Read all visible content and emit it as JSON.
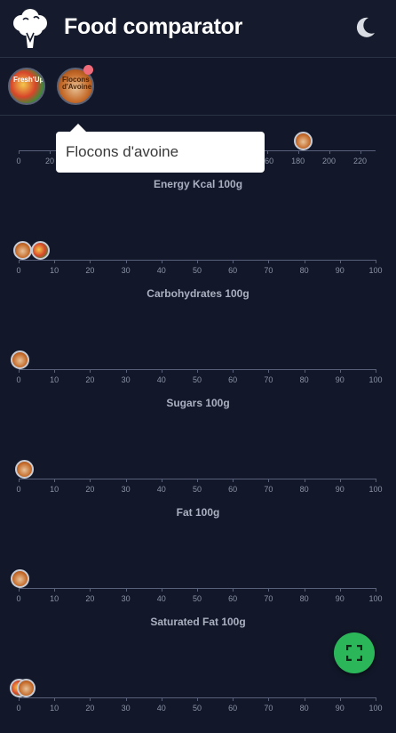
{
  "header": {
    "title": "Food comparator",
    "logo_icon": "broccoli-icon",
    "theme_toggle_icon": "moon-icon"
  },
  "selected_products": [
    {
      "name": "pizza",
      "label": "Fresh'Up"
    },
    {
      "name": "oat-flakes",
      "label": "Flocons d'Avoine"
    }
  ],
  "tooltip": {
    "text": "Flocons d'avoine"
  },
  "colors": {
    "background": "#121829",
    "fab": "#2bb65a",
    "badge": "#f06b7a"
  },
  "fab": {
    "icon": "fullscreen-icon"
  },
  "chart_data": [
    {
      "type": "scatter",
      "title": "Energy Kcal 100g",
      "ticks": [
        "0",
        "20",
        "40",
        "60",
        "80",
        "100",
        "120",
        "140",
        "160",
        "180",
        "200",
        "220"
      ],
      "xlim": [
        0,
        230
      ],
      "points": [
        {
          "product": "pizza",
          "x": 107
        },
        {
          "product": "oat-flakes",
          "x": 183
        }
      ]
    },
    {
      "type": "scatter",
      "title": "Carbohydrates 100g",
      "ticks": [
        "0",
        "10",
        "20",
        "30",
        "40",
        "50",
        "60",
        "70",
        "80",
        "90",
        "100"
      ],
      "xlim": [
        0,
        100
      ],
      "points": [
        {
          "product": "oat-flakes",
          "x": 1
        },
        {
          "product": "pizza",
          "x": 6
        }
      ]
    },
    {
      "type": "scatter",
      "title": "Sugars 100g",
      "ticks": [
        "0",
        "10",
        "20",
        "30",
        "40",
        "50",
        "60",
        "70",
        "80",
        "90",
        "100"
      ],
      "xlim": [
        0,
        100
      ],
      "points": [
        {
          "product": "oat-flakes",
          "x": 0.3
        }
      ]
    },
    {
      "type": "scatter",
      "title": "Fat 100g",
      "ticks": [
        "0",
        "10",
        "20",
        "30",
        "40",
        "50",
        "60",
        "70",
        "80",
        "90",
        "100"
      ],
      "xlim": [
        0,
        100
      ],
      "points": [
        {
          "product": "oat-flakes",
          "x": 1.4
        }
      ]
    },
    {
      "type": "scatter",
      "title": "Saturated Fat 100g",
      "ticks": [
        "0",
        "10",
        "20",
        "30",
        "40",
        "50",
        "60",
        "70",
        "80",
        "90",
        "100"
      ],
      "xlim": [
        0,
        100
      ],
      "points": [
        {
          "product": "oat-flakes",
          "x": 0.3
        }
      ]
    },
    {
      "type": "scatter",
      "title": "",
      "ticks": [
        "0",
        "10",
        "20",
        "30",
        "40",
        "50",
        "60",
        "70",
        "80",
        "90",
        "100"
      ],
      "xlim": [
        0,
        100
      ],
      "points": [
        {
          "product": "pizza",
          "x": 0.1
        },
        {
          "product": "oat-flakes",
          "x": 2
        }
      ]
    }
  ]
}
